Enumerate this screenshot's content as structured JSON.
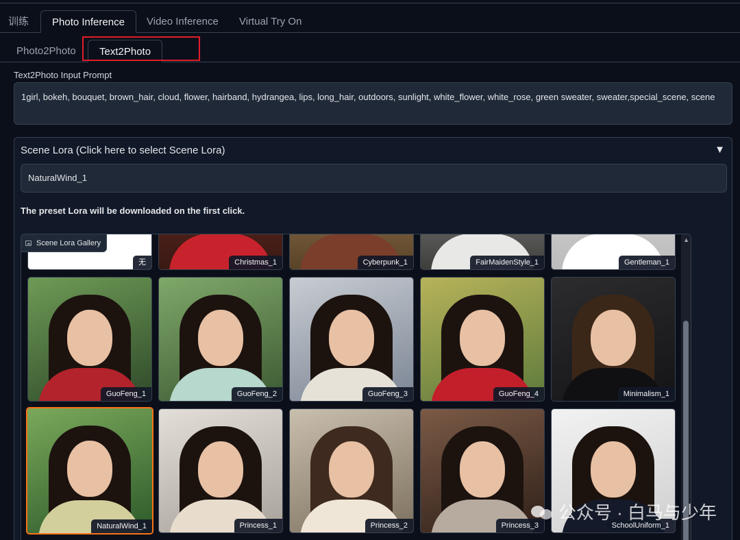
{
  "main_tabs": [
    "训练",
    "Photo Inference",
    "Video Inference",
    "Virtual Try On"
  ],
  "sub_tabs": [
    "Photo2Photo",
    "Text2Photo"
  ],
  "prompt": {
    "label": "Text2Photo Input Prompt",
    "value": "1girl, bokeh, bouquet, brown_hair, cloud, flower, hairband, hydrangea, lips, long_hair, outdoors, sunlight, white_flower, white_rose, green sweater, sweater,special_scene, scene"
  },
  "scene_lora": {
    "title": "Scene Lora (Click here to select Scene Lora)",
    "arrow": "▼",
    "selected": "NaturalWind_1",
    "note": "The preset Lora will be downloaded on the first click."
  },
  "gallery": {
    "label": "Scene Lora Gallery",
    "rows": [
      [
        "无",
        "Christmas_1",
        "Cyberpunk_1",
        "FairMaidenStyle_1",
        "Gentleman_1"
      ],
      [
        "GuoFeng_1",
        "GuoFeng_2",
        "GuoFeng_3",
        "GuoFeng_4",
        "Minimalism_1"
      ],
      [
        "NaturalWind_1",
        "Princess_1",
        "Princess_2",
        "Princess_3",
        "SchoolUniform_1"
      ]
    ]
  },
  "watermark": "公众号 · 白马与少年"
}
